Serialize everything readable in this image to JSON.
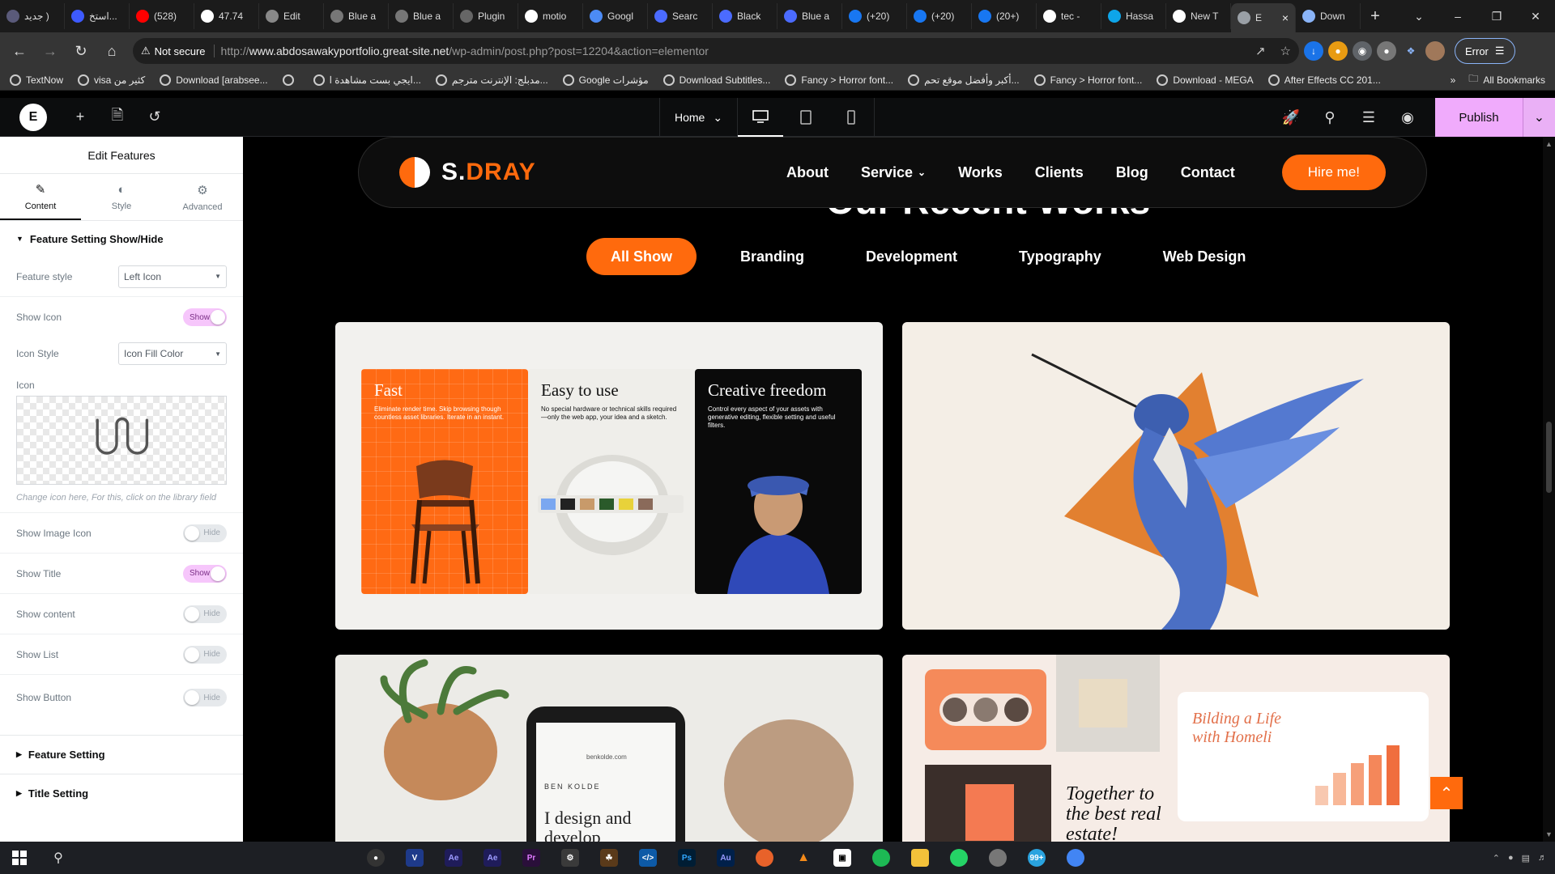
{
  "browser": {
    "tabs": [
      {
        "label": "جديد )",
        "color": "#5a5a7a"
      },
      {
        "label": "استخ...",
        "color": "#3d5afe"
      },
      {
        "label": "(528)",
        "color": "#ff0000"
      },
      {
        "label": "47.74",
        "color": "#ffffff"
      },
      {
        "label": "Edit",
        "color": "#888888"
      },
      {
        "label": "Blue a",
        "color": "#777777"
      },
      {
        "label": "Blue a",
        "color": "#777777"
      },
      {
        "label": "Plugin",
        "color": "#666666"
      },
      {
        "label": "motio",
        "color": "#ffffff"
      },
      {
        "label": "Googl",
        "color": "#4c8bf5"
      },
      {
        "label": "Searc",
        "color": "#4b6bff"
      },
      {
        "label": "Black",
        "color": "#4b6bff"
      },
      {
        "label": "Blue a",
        "color": "#4b6bff"
      },
      {
        "label": "(+20)",
        "color": "#1877f2"
      },
      {
        "label": "(+20)",
        "color": "#1877f2"
      },
      {
        "label": "(20+)",
        "color": "#1877f2"
      },
      {
        "label": "tec -",
        "color": "#ffffff"
      },
      {
        "label": "Hassa",
        "color": "#0ea5e9"
      },
      {
        "label": "New T",
        "color": "#ffffff"
      },
      {
        "label": "E",
        "color": "#9aa0a6",
        "active": true
      },
      {
        "label": "Down",
        "color": "#8ab4f8"
      }
    ],
    "url_domain": "www.abdosawakyportfolio.great-site.net",
    "url_path": "/wp-admin/post.php?post=12204&action=elementor",
    "not_secure": "Not secure",
    "error_label": "Error",
    "bookmarks": [
      "TextNow",
      "visa كثير من",
      "Download [arabsee...",
      "",
      "ايجي بست مشاهدة ا...",
      "مدبلج: الإنترنت مترجم...",
      "Google مؤشرات",
      "Download Subtitles...",
      "Fancy > Horror font...",
      "أكبر وأفضل موقع تحم...",
      "Fancy > Horror font...",
      "Download - MEGA",
      "After Effects CC 201..."
    ],
    "all_bookmarks": "All Bookmarks"
  },
  "editor": {
    "page_name": "Home",
    "publish": "Publish"
  },
  "panel": {
    "title": "Edit Features",
    "tabs": [
      "Content",
      "Style",
      "Advanced"
    ],
    "section": "Feature Setting Show/Hide",
    "feature_style": {
      "label": "Feature style",
      "value": "Left Icon"
    },
    "show_icon": {
      "label": "Show Icon",
      "state": "Show"
    },
    "icon_style": {
      "label": "Icon Style",
      "value": "Icon Fill Color"
    },
    "icon_label": "Icon",
    "icon_hint": "Change icon here, For this, click on the library field",
    "show_image_icon": {
      "label": "Show Image Icon",
      "state": "Hide"
    },
    "show_title": {
      "label": "Show Title",
      "state": "Show"
    },
    "show_content": {
      "label": "Show content",
      "state": "Hide"
    },
    "show_list": {
      "label": "Show List",
      "state": "Hide"
    },
    "show_button": {
      "label": "Show Button",
      "state": "Hide"
    },
    "collapsed_sections": [
      "Feature Setting",
      "Title Setting"
    ]
  },
  "site": {
    "brand_prefix": "S.",
    "brand_accent": "DRAY",
    "menu": [
      "About",
      "Service",
      "Works",
      "Clients",
      "Blog",
      "Contact"
    ],
    "hire": "Hire me!",
    "heading": "Our Recent Works",
    "filters": [
      "All Show",
      "Branding",
      "Development",
      "Typography",
      "Web Design"
    ],
    "active_filter": "All Show",
    "accent_color": "#ff6a0d",
    "card1": {
      "fast_title": "Fast",
      "fast_text": "Eliminate render time. Skip browsing though countless asset libraries. Iterate in an instant.",
      "easy_title": "Easy to use",
      "easy_text": "No special hardware or technical skills required—only the web app, your idea and a sketch.",
      "free_title": "Creative freedom",
      "free_text": "Control every aspect of your assets with generative editing, flexible setting and useful filters."
    },
    "card3": {
      "brand": "BEN KOLDE",
      "domain": "benkolde.com",
      "headline": "I design and develop"
    },
    "card4": {
      "headline1": "Bilding a Life with Homeli",
      "headline2": "Together to the best real estate!"
    }
  }
}
